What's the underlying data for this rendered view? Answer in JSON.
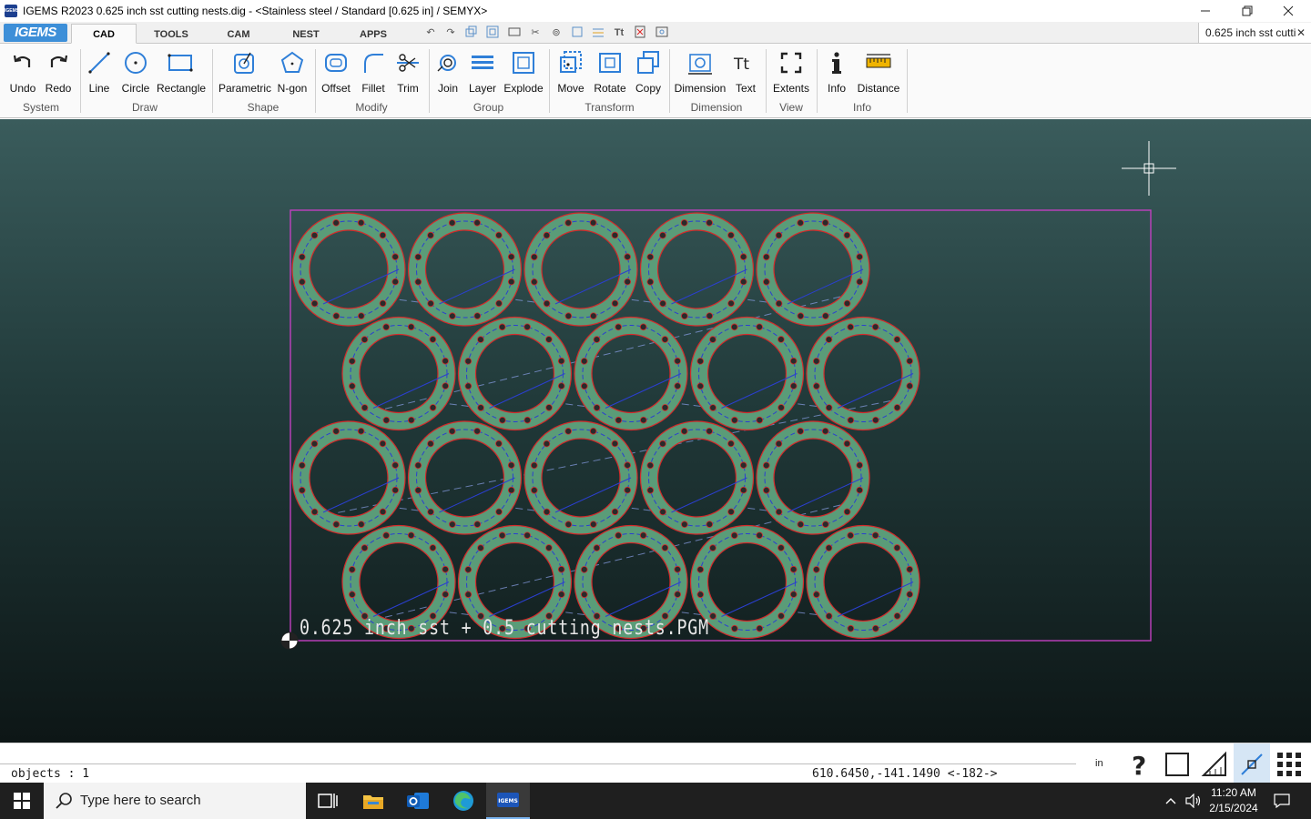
{
  "window": {
    "title": "IGEMS R2023  0.625 inch sst cutting nests.dig - <Stainless steel / Standard [0.625 in] / SEMYX>",
    "app_icon_text": "IGEMS"
  },
  "ribbon_tabs": {
    "logo": "IGEMS",
    "tabs": [
      {
        "label": "CAD",
        "active": true
      },
      {
        "label": "TOOLS",
        "active": false
      },
      {
        "label": "CAM",
        "active": false
      },
      {
        "label": "NEST",
        "active": false
      },
      {
        "label": "APPS",
        "active": false
      }
    ],
    "quick_access_icons": [
      "undo-icon",
      "redo-icon",
      "copy-icon",
      "group-icon",
      "rectangle-icon",
      "trim-icon",
      "join-icon",
      "select-icon",
      "layer-icon",
      "text-icon",
      "delete-icon",
      "view-icon"
    ],
    "document_tab": "0.625 inch sst cutti"
  },
  "ribbon": {
    "tools": [
      {
        "label": "Undo",
        "icon": "undo-icon"
      },
      {
        "label": "Redo",
        "icon": "redo-icon"
      },
      {
        "label": "Line",
        "icon": "line-icon"
      },
      {
        "label": "Circle",
        "icon": "circle-icon"
      },
      {
        "label": "Rectangle",
        "icon": "rectangle-icon"
      },
      {
        "label": "Parametric",
        "icon": "parametric-icon"
      },
      {
        "label": "N-gon",
        "icon": "ngon-icon"
      },
      {
        "label": "Offset",
        "icon": "offset-icon"
      },
      {
        "label": "Fillet",
        "icon": "fillet-icon"
      },
      {
        "label": "Trim",
        "icon": "trim-icon"
      },
      {
        "label": "Join",
        "icon": "join-icon"
      },
      {
        "label": "Layer",
        "icon": "layer-icon"
      },
      {
        "label": "Explode",
        "icon": "explode-icon"
      },
      {
        "label": "Move",
        "icon": "move-icon"
      },
      {
        "label": "Rotate",
        "icon": "rotate-icon"
      },
      {
        "label": "Copy",
        "icon": "copy-icon"
      },
      {
        "label": "Dimension",
        "icon": "dimension-icon"
      },
      {
        "label": "Text",
        "icon": "text-icon"
      },
      {
        "label": "Extents",
        "icon": "extents-icon"
      },
      {
        "label": "Info",
        "icon": "info-icon"
      },
      {
        "label": "Distance",
        "icon": "ruler-icon"
      }
    ],
    "groups": [
      "System",
      "Draw",
      "Shape",
      "Modify",
      "Group",
      "Transform",
      "Dimension",
      "View",
      "Info"
    ]
  },
  "canvas": {
    "nest_label": "0.625 inch sst + 0.5 cutting nests.PGM",
    "grid": {
      "rows": 4,
      "columns": 5
    },
    "colors": {
      "sheet_border": "#c040c0",
      "part_fill": "#5a9c78",
      "part_outline": "#d42a2a",
      "bolt_circle": "#2b3fd0",
      "lead_path": "#2b3fd0",
      "hole": "#2a2a2a"
    }
  },
  "status": {
    "objects": "objects : 1",
    "coordinates": "610.6450,-141.1490 <-182->",
    "units": "in",
    "icons": [
      "help-icon",
      "square-icon",
      "angle-icon",
      "snap-icon",
      "grid-icon"
    ]
  },
  "taskbar": {
    "search_placeholder": "Type here to search",
    "apps": [
      "task-view-icon",
      "file-explorer-icon",
      "outlook-icon",
      "edge-icon",
      "igems-icon"
    ],
    "igems_label": "IGEMS",
    "time": "11:20 AM",
    "date": "2/15/2024"
  }
}
